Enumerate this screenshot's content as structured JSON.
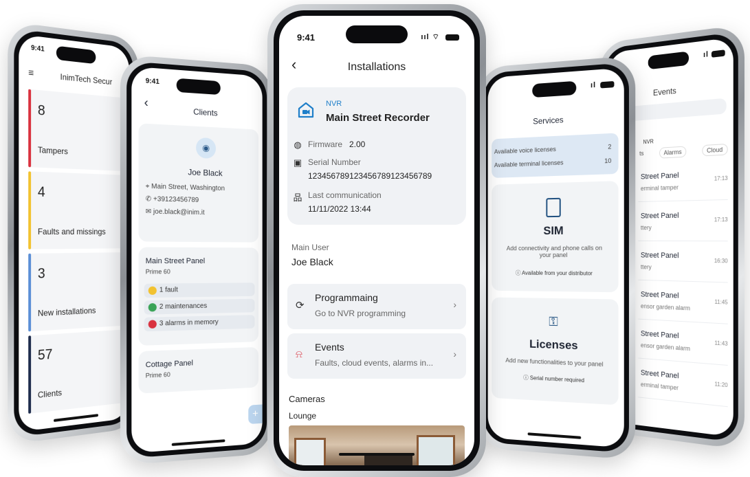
{
  "phone_dashboard": {
    "time": "9:41",
    "title": "InimTech Secur",
    "tiles": [
      {
        "count": "8",
        "label": "Tampers",
        "color": "#d9323f"
      },
      {
        "count": "4",
        "label": "Faults and missings",
        "color": "#f2c230"
      },
      {
        "count": "3",
        "label": "New installations",
        "color": "#5b8fd6"
      },
      {
        "count": "57",
        "label": "Clients",
        "color": "#1f2d4d"
      }
    ]
  },
  "phone_clients": {
    "time": "9:41",
    "back": "‹",
    "title": "Clients",
    "client_name": "Joe Black",
    "address": "Main Street, Washington",
    "phone": "+39123456789",
    "email": "joe.black@inim.it",
    "panels": [
      {
        "name": "Main Street Panel",
        "model": "Prime 60"
      },
      {
        "name": "Cottage Panel",
        "model": "Prime 60"
      }
    ],
    "chips": [
      {
        "text": "1 fault",
        "color": "#f2c230"
      },
      {
        "text": "2 maintenances",
        "color": "#3aa357"
      },
      {
        "text": "3 alarms in memory",
        "color": "#d9323f"
      }
    ],
    "fab": "+"
  },
  "phone_installations": {
    "time": "9:41",
    "back": "‹",
    "title": "Installations",
    "device_type": "NVR",
    "device_name": "Main Street Recorder",
    "firmware_label": "Firmware",
    "firmware_value": "2.00",
    "serial_label": "Serial Number",
    "serial_value": "123456789123456789123456789",
    "lastcomm_label": "Last communication",
    "lastcomm_value": "11/11/2022 13:44",
    "main_user_label": "Main User",
    "main_user_value": "Joe Black",
    "menu": [
      {
        "title": "Programmaing",
        "subtitle": "Go to NVR programming",
        "icon": "programming-icon"
      },
      {
        "title": "Events",
        "subtitle": "Faults, cloud events, alarms in...",
        "icon": "alarm-bell-icon"
      }
    ],
    "cameras_label": "Cameras",
    "camera_name": "Lounge",
    "accent": "#1f7fc9"
  },
  "phone_services": {
    "title": "Services",
    "voice_label": "Available voice licenses",
    "voice_value": "2",
    "terminal_label": "Available terminal licenses",
    "terminal_value": "10",
    "sim_title": "SIM",
    "sim_desc": "Add connectivity and phone calls on your panel",
    "sim_note": "Available from your distributor",
    "lic_title": "Licenses",
    "lic_desc": "Add new functionalities to your panel",
    "lic_note": "Serial number required"
  },
  "phone_events": {
    "title": "Events",
    "filter_label": "NVR",
    "filters": [
      "ts",
      "Alarms",
      "Cloud"
    ],
    "events": [
      {
        "title": "Street Panel",
        "sub": "erminal tamper",
        "time": "17:13"
      },
      {
        "title": "Street Panel",
        "sub": "ttery",
        "time": "17:13"
      },
      {
        "title": "Street Panel",
        "sub": "ttery",
        "time": "16:30"
      },
      {
        "title": "Street Panel",
        "sub": "ensor garden alarm",
        "time": "11:45"
      },
      {
        "title": "Street Panel",
        "sub": "ensor garden alarm",
        "time": "11:43"
      },
      {
        "title": "Street Panel",
        "sub": "erminal tamper",
        "time": "11:20"
      }
    ]
  }
}
